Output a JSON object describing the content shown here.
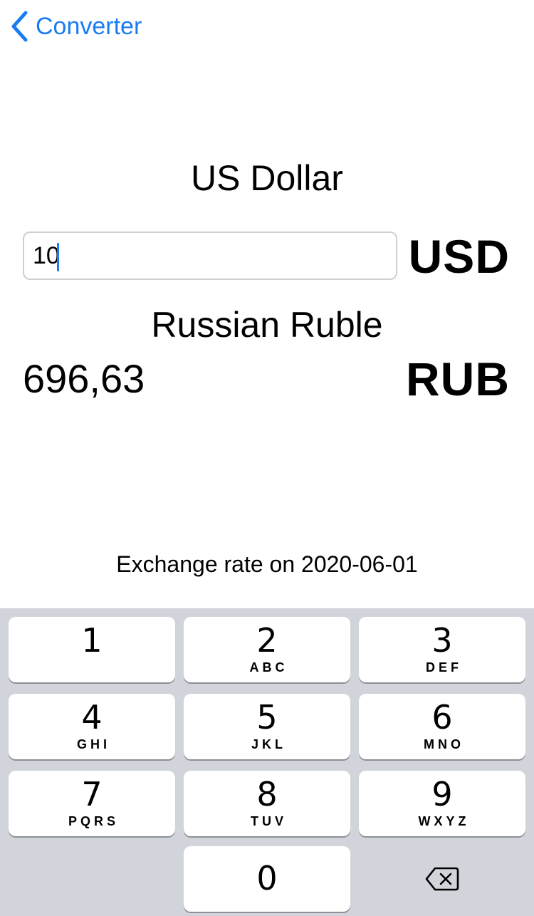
{
  "nav": {
    "back_label": "Converter"
  },
  "from": {
    "name": "US Dollar",
    "code": "USD",
    "amount": "10"
  },
  "to": {
    "name": "Russian Ruble",
    "code": "RUB",
    "amount": "696,63"
  },
  "rate": {
    "text": "Exchange rate on 2020-06-01"
  },
  "keypad": {
    "keys": [
      {
        "digit": "1",
        "letters": ""
      },
      {
        "digit": "2",
        "letters": "ABC"
      },
      {
        "digit": "3",
        "letters": "DEF"
      },
      {
        "digit": "4",
        "letters": "GHI"
      },
      {
        "digit": "5",
        "letters": "JKL"
      },
      {
        "digit": "6",
        "letters": "MNO"
      },
      {
        "digit": "7",
        "letters": "PQRS"
      },
      {
        "digit": "8",
        "letters": "TUV"
      },
      {
        "digit": "9",
        "letters": "WXYZ"
      },
      {
        "digit": "0",
        "letters": ""
      }
    ],
    "delete_icon": "backspace-icon"
  },
  "colors": {
    "accent": "#1a7cf4",
    "keypad_background": "#d1d4da",
    "key_background": "#ffffff"
  }
}
